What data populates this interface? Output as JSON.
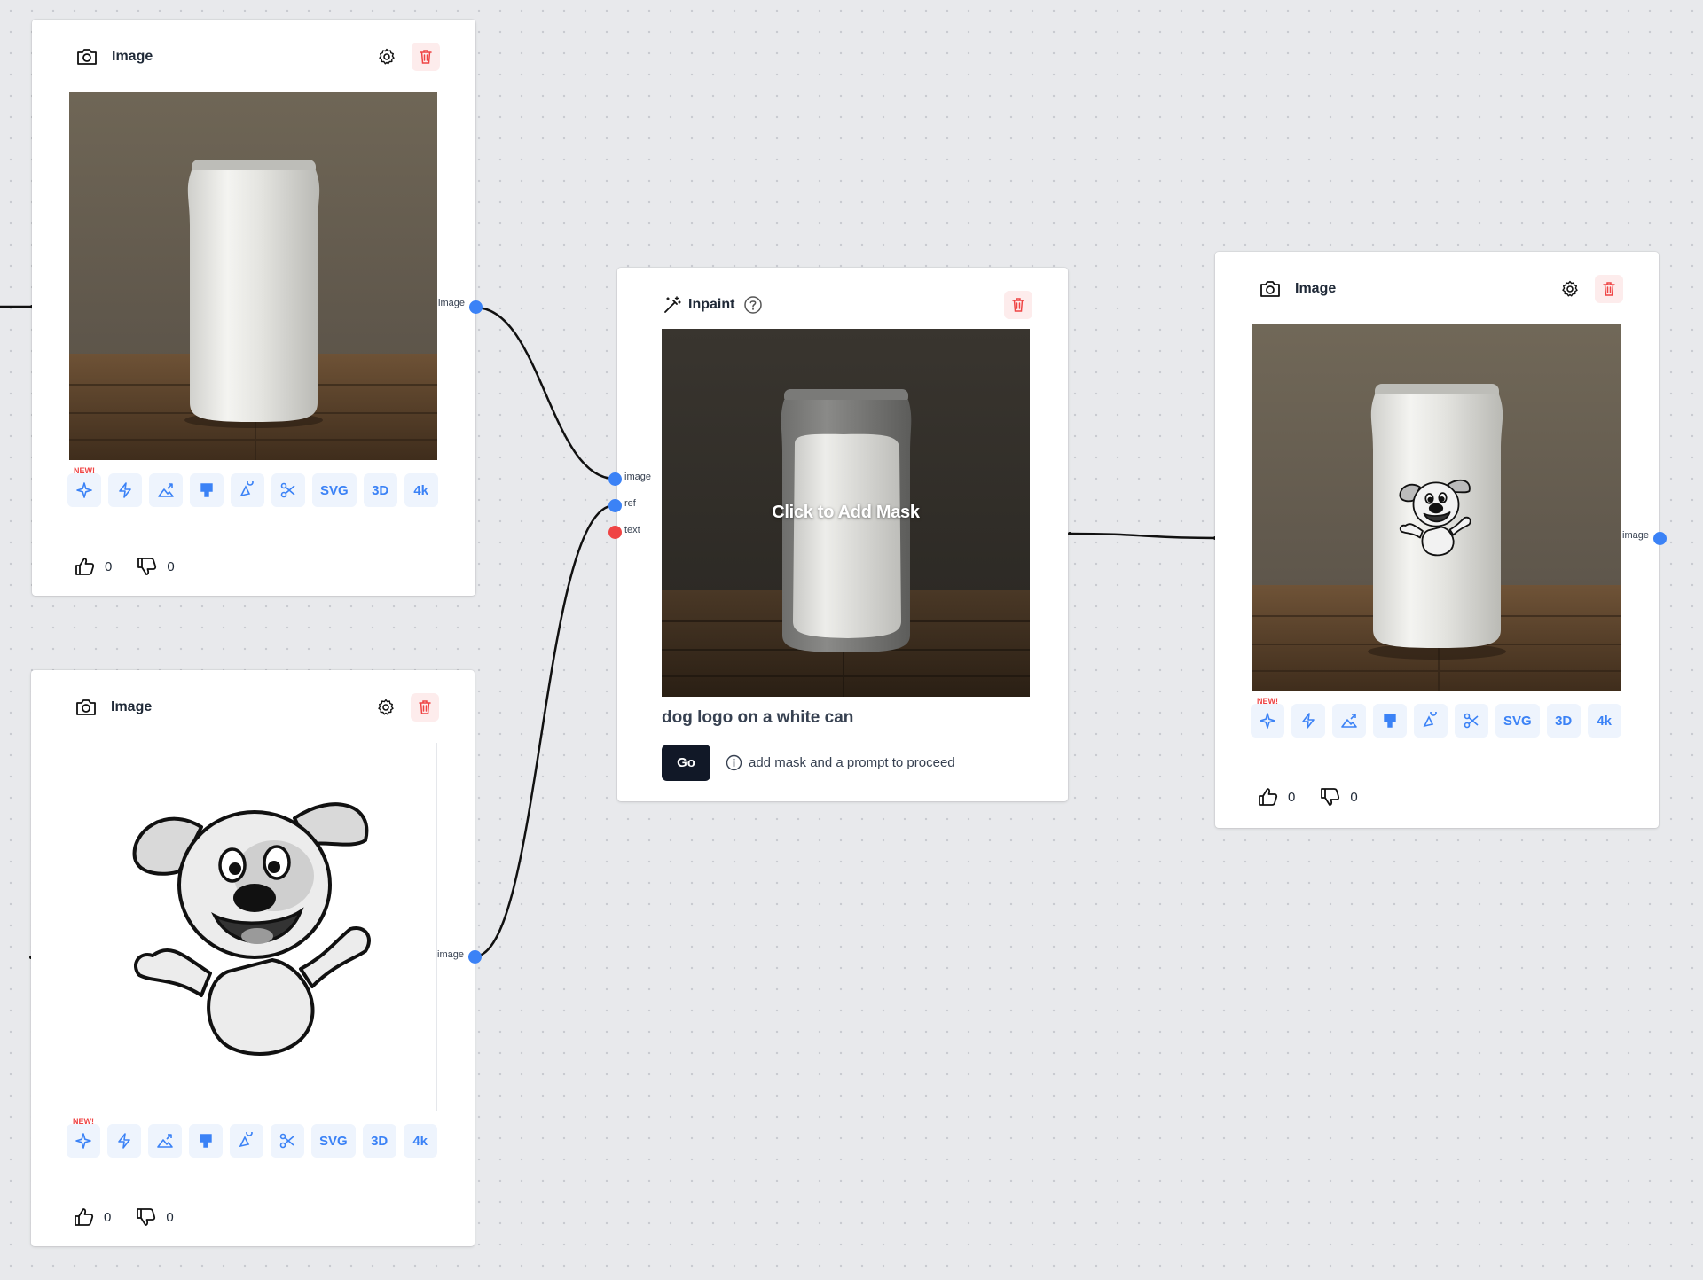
{
  "nodes": {
    "image_top": {
      "title": "Image",
      "output_label": "image",
      "new_badge": "NEW!",
      "tools": [
        "SVG",
        "3D",
        "4k"
      ],
      "likes": "0",
      "dislikes": "0"
    },
    "image_bottom": {
      "title": "Image",
      "output_label": "image",
      "new_badge": "NEW!",
      "tools": [
        "SVG",
        "3D",
        "4k"
      ],
      "likes": "0",
      "dislikes": "0"
    },
    "inpaint": {
      "title": "Inpaint",
      "inputs": [
        "image",
        "ref",
        "text"
      ],
      "mask_label": "Click to Add Mask",
      "prompt": "dog logo on a white can",
      "go_label": "Go",
      "hint": "add mask and a prompt to proceed"
    },
    "image_result": {
      "title": "Image",
      "output_label": "image",
      "new_badge": "NEW!",
      "tools": [
        "SVG",
        "3D",
        "4k"
      ],
      "likes": "0",
      "dislikes": "0"
    }
  },
  "colors": {
    "accent": "#3b82f6",
    "danger": "#ef4444",
    "canvas": "#e8e9ec",
    "button_dark": "#111827"
  },
  "icons": {
    "node_header": "camera-icon",
    "inpaint_header": "magic-wand-icon",
    "tools": [
      "sparkles-icon",
      "lightning-icon",
      "upscale-icon",
      "brush-icon",
      "shapes-icon",
      "scissors-icon"
    ]
  }
}
